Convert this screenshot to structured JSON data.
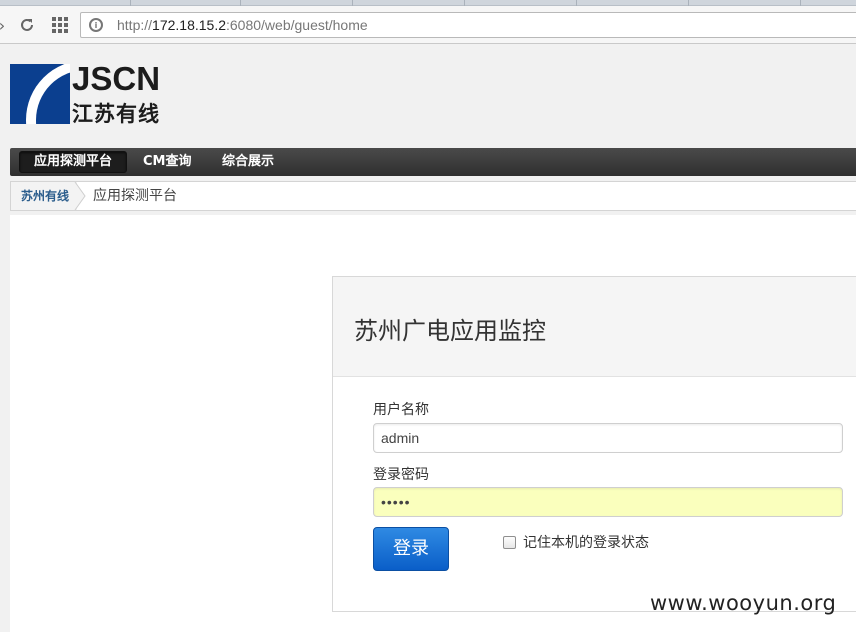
{
  "browser": {
    "url_prefix": "http://",
    "url_host": "172.18.15.2",
    "url_rest": ":6080/web/guest/home"
  },
  "header": {
    "logo_brand": "JSCN",
    "logo_cn": "江苏有线"
  },
  "nav": {
    "items": [
      {
        "label": "应用探测平台",
        "active": true
      },
      {
        "label": "CM查询",
        "active": false
      },
      {
        "label": "综合展示",
        "active": false
      }
    ]
  },
  "breadcrumb": {
    "home": "苏州有线",
    "current": "应用探测平台"
  },
  "login": {
    "title": "苏州广电应用监控",
    "username_label": "用户名称",
    "username_value": "admin",
    "password_label": "登录密码",
    "password_value": "•••••",
    "submit_label": "登录",
    "remember_label": "记住本机的登录状态",
    "remember_checked": false
  },
  "watermark": "www.wooyun.org",
  "colors": {
    "nav_bg": "#333333",
    "button_blue": "#0a5ec8",
    "autofill_yellow": "#faffbd",
    "breadcrumb_link": "#2b5d8c"
  }
}
